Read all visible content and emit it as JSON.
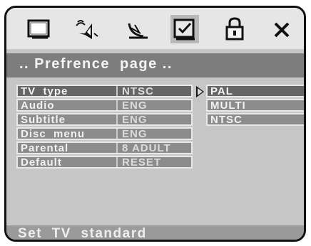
{
  "icon_tabs": [
    {
      "icon": "tv-screen-icon",
      "active": false
    },
    {
      "icon": "speaker-audio-icon",
      "active": false
    },
    {
      "icon": "satellite-dish-icon",
      "active": false
    },
    {
      "icon": "checkbox-preference-icon",
      "active": true
    },
    {
      "icon": "padlock-icon",
      "active": false
    },
    {
      "icon": "close-x-icon",
      "active": false
    }
  ],
  "title": ".. Prefrence  page ..",
  "menu": [
    {
      "label": "TV  type",
      "value": "NTSC",
      "selected": true
    },
    {
      "label": "Audio",
      "value": "ENG",
      "selected": false
    },
    {
      "label": "Subtitle",
      "value": "ENG",
      "selected": false
    },
    {
      "label": "Disc  menu",
      "value": "ENG",
      "selected": false
    },
    {
      "label": "Parental",
      "value": "8 ADULT",
      "selected": false
    },
    {
      "label": "Default",
      "value": "RESET",
      "selected": false
    }
  ],
  "submenu": [
    {
      "label": "PAL",
      "selected": true
    },
    {
      "label": "MULTI",
      "selected": false
    },
    {
      "label": "NTSC",
      "selected": false
    }
  ],
  "status": "Set  TV  standard",
  "colors": {
    "panel_bg": "#c6c6c6",
    "iconbar_bg": "#e6e6e6",
    "titlebar_bg": "#7d7d7d",
    "row_bg": "#8c8c8c",
    "row_selected_bg": "#666666"
  }
}
